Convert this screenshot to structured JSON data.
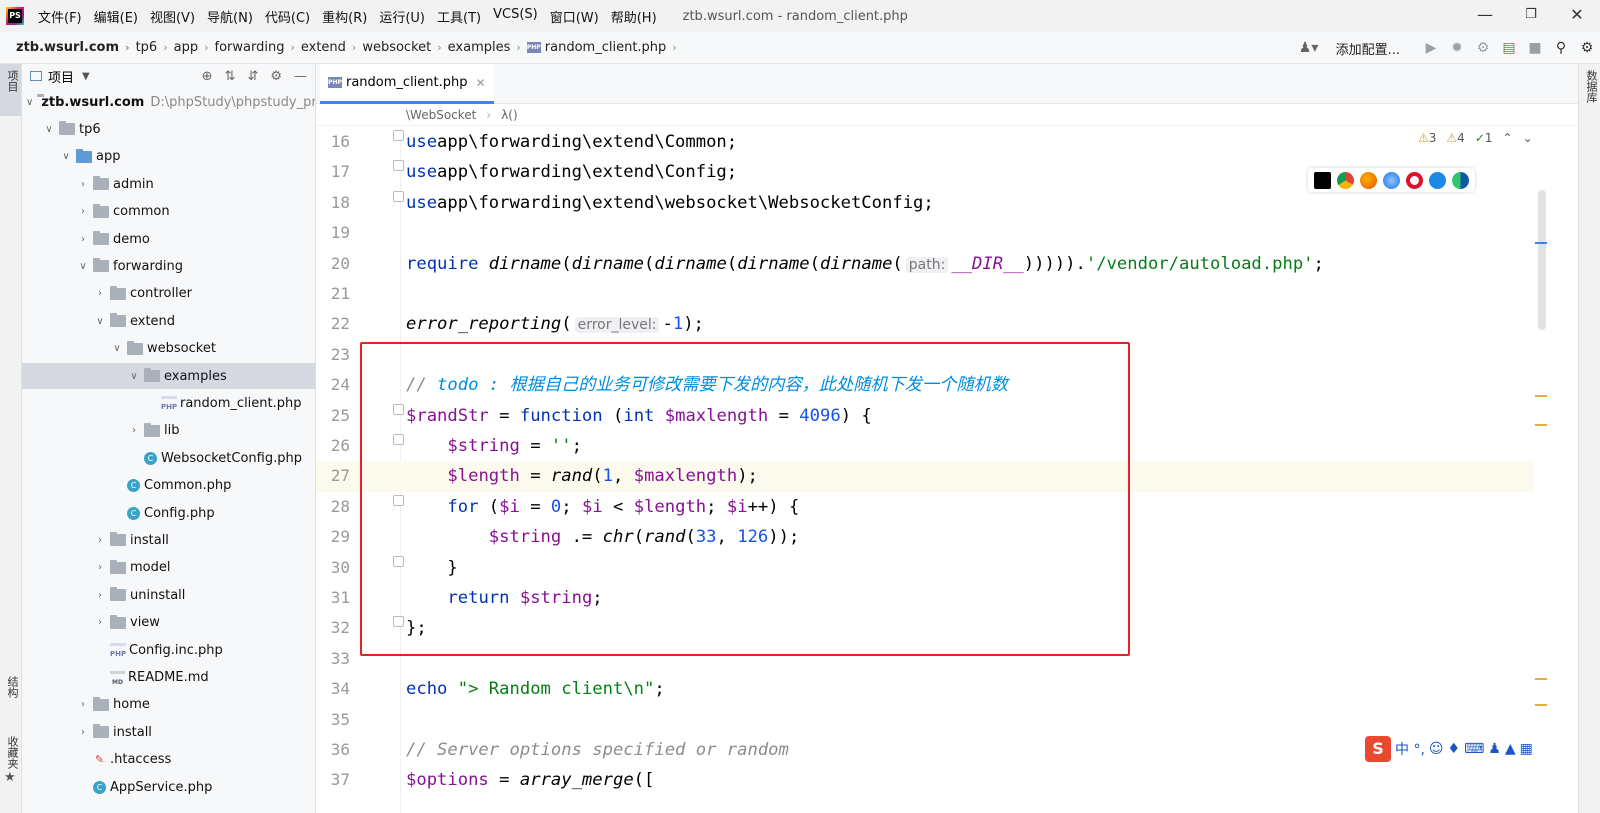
{
  "titlebar": {
    "app_icon": "phpstorm-icon",
    "logo_text": "PS",
    "menus": [
      "文件(F)",
      "编辑(E)",
      "视图(V)",
      "导航(N)",
      "代码(C)",
      "重构(R)",
      "运行(U)",
      "工具(T)",
      "VCS(S)",
      "窗口(W)",
      "帮助(H)"
    ],
    "title": "ztb.wsurl.com - random_client.php"
  },
  "navbar": {
    "crumbs": [
      "ztb.wsurl.com",
      "tp6",
      "app",
      "forwarding",
      "extend",
      "websocket",
      "examples",
      "random_client.php"
    ],
    "php_badge": "PHP",
    "add_config": "添加配置..."
  },
  "left_strip": {
    "project": "项目",
    "structure": "结构",
    "favorites": "收藏夹"
  },
  "right_strip": {
    "database": "数据库"
  },
  "project": {
    "title": "项目",
    "tree": [
      {
        "label": "ztb.wsurl.com",
        "path": "D:\\phpStudy\\phpstudy_pro\\W",
        "indent": 0,
        "icon": "folder",
        "open": true,
        "bold": true
      },
      {
        "label": "tp6",
        "indent": 1,
        "icon": "folder",
        "open": true
      },
      {
        "label": "app",
        "indent": 2,
        "icon": "folder-blue",
        "open": true
      },
      {
        "label": "admin",
        "indent": 3,
        "icon": "folder",
        "open": false
      },
      {
        "label": "common",
        "indent": 3,
        "icon": "folder",
        "open": false
      },
      {
        "label": "demo",
        "indent": 3,
        "icon": "folder",
        "open": false
      },
      {
        "label": "forwarding",
        "indent": 3,
        "icon": "folder",
        "open": true
      },
      {
        "label": "controller",
        "indent": 4,
        "icon": "folder",
        "open": false
      },
      {
        "label": "extend",
        "indent": 4,
        "icon": "folder",
        "open": true
      },
      {
        "label": "websocket",
        "indent": 5,
        "icon": "folder",
        "open": true
      },
      {
        "label": "examples",
        "indent": 6,
        "icon": "folder",
        "open": true,
        "selected": true
      },
      {
        "label": "random_client.php",
        "indent": 7,
        "icon": "php"
      },
      {
        "label": "lib",
        "indent": 6,
        "icon": "folder",
        "open": false
      },
      {
        "label": "WebsocketConfig.php",
        "indent": 6,
        "icon": "class"
      },
      {
        "label": "Common.php",
        "indent": 5,
        "icon": "class"
      },
      {
        "label": "Config.php",
        "indent": 5,
        "icon": "class"
      },
      {
        "label": "install",
        "indent": 4,
        "icon": "folder",
        "open": false
      },
      {
        "label": "model",
        "indent": 4,
        "icon": "folder",
        "open": false
      },
      {
        "label": "uninstall",
        "indent": 4,
        "icon": "folder",
        "open": false
      },
      {
        "label": "view",
        "indent": 4,
        "icon": "folder",
        "open": false
      },
      {
        "label": "Config.inc.php",
        "indent": 4,
        "icon": "php"
      },
      {
        "label": "README.md",
        "indent": 4,
        "icon": "md"
      },
      {
        "label": "home",
        "indent": 3,
        "icon": "folder",
        "open": false
      },
      {
        "label": "install",
        "indent": 3,
        "icon": "folder",
        "open": false
      },
      {
        "label": ".htaccess",
        "indent": 3,
        "icon": "htaccess"
      },
      {
        "label": "AppService.php",
        "indent": 3,
        "icon": "class"
      }
    ]
  },
  "editor": {
    "tab": "random_client.php",
    "breadcrumb": [
      "\\WebSocket",
      "λ()"
    ],
    "inspections": {
      "warnings": "3",
      "weak_warnings": "4",
      "typos": "1"
    },
    "current_line": 27,
    "lines": [
      {
        "n": "16",
        "t": [
          [
            "kw",
            "use"
          ],
          [
            "",
            "app\\forwarding\\extend\\Common;"
          ]
        ]
      },
      {
        "n": "17",
        "t": [
          [
            "kw",
            "use"
          ],
          [
            "",
            "app\\forwarding\\extend\\Config;"
          ]
        ]
      },
      {
        "n": "18",
        "t": [
          [
            "kw",
            "use"
          ],
          [
            "",
            "app\\forwarding\\extend\\websocket\\WebsocketConfig;"
          ]
        ]
      },
      {
        "n": "19",
        "t": []
      },
      {
        "n": "20",
        "t": [
          [
            "kw",
            "require "
          ],
          [
            "fn",
            "dirname"
          ],
          [
            "",
            "("
          ],
          [
            "fn",
            "dirname"
          ],
          [
            "",
            "("
          ],
          [
            "fn",
            "dirname"
          ],
          [
            "",
            "("
          ],
          [
            "fn",
            "dirname"
          ],
          [
            "",
            "("
          ],
          [
            "fn",
            "dirname"
          ],
          [
            "",
            "("
          ],
          [
            "hint",
            "path:"
          ],
          [
            "const",
            "__DIR__"
          ],
          [
            "",
            ")))))."
          ],
          [
            "str",
            "'/vendor/autoload.php'"
          ],
          [
            "",
            ";"
          ]
        ]
      },
      {
        "n": "21",
        "t": []
      },
      {
        "n": "22",
        "t": [
          [
            "fn",
            "error_reporting"
          ],
          [
            "",
            "("
          ],
          [
            "hint",
            "error_level:"
          ],
          [
            "",
            "-"
          ],
          [
            "num",
            "1"
          ],
          [
            "",
            ");"
          ]
        ]
      },
      {
        "n": "23",
        "t": []
      },
      {
        "n": "24",
        "t": [
          [
            "cmt",
            "// "
          ],
          [
            "todo",
            "todo : 根据自己的业务可修改需要下发的内容，此处随机下发一个随机数"
          ]
        ]
      },
      {
        "n": "25",
        "t": [
          [
            "var",
            "$randStr"
          ],
          [
            "",
            " = "
          ],
          [
            "kw",
            "function"
          ],
          [
            "",
            " ("
          ],
          [
            "kw",
            "int"
          ],
          [
            "",
            " "
          ],
          [
            "var",
            "$maxlength"
          ],
          [
            "",
            " = "
          ],
          [
            "num",
            "4096"
          ],
          [
            "",
            ") {"
          ]
        ]
      },
      {
        "n": "26",
        "t": [
          [
            "",
            "    "
          ],
          [
            "var",
            "$string"
          ],
          [
            "",
            " = "
          ],
          [
            "str",
            "''"
          ],
          [
            "",
            ";"
          ]
        ]
      },
      {
        "n": "27",
        "t": [
          [
            "",
            "    "
          ],
          [
            "var",
            "$length"
          ],
          [
            "",
            " = "
          ],
          [
            "fn",
            "rand"
          ],
          [
            "",
            "("
          ],
          [
            "num",
            "1"
          ],
          [
            "",
            ", "
          ],
          [
            "var",
            "$maxlength"
          ],
          [
            "",
            ");"
          ]
        ]
      },
      {
        "n": "28",
        "t": [
          [
            "",
            "    "
          ],
          [
            "kw",
            "for"
          ],
          [
            "",
            " ("
          ],
          [
            "var",
            "$i"
          ],
          [
            "",
            " = "
          ],
          [
            "num",
            "0"
          ],
          [
            "",
            "; "
          ],
          [
            "var",
            "$i"
          ],
          [
            "",
            " < "
          ],
          [
            "var",
            "$length"
          ],
          [
            "",
            "; "
          ],
          [
            "var",
            "$i"
          ],
          [
            "",
            "++) {"
          ]
        ]
      },
      {
        "n": "29",
        "t": [
          [
            "",
            "        "
          ],
          [
            "var",
            "$string"
          ],
          [
            "",
            " .= "
          ],
          [
            "fn",
            "chr"
          ],
          [
            "",
            "("
          ],
          [
            "fn",
            "rand"
          ],
          [
            "",
            "("
          ],
          [
            "num",
            "33"
          ],
          [
            "",
            ", "
          ],
          [
            "num",
            "126"
          ],
          [
            "",
            "));"
          ]
        ]
      },
      {
        "n": "30",
        "t": [
          [
            "",
            "    }"
          ]
        ]
      },
      {
        "n": "31",
        "t": [
          [
            "",
            "    "
          ],
          [
            "kw",
            "return"
          ],
          [
            "",
            " "
          ],
          [
            "var",
            "$string"
          ],
          [
            "",
            ";"
          ]
        ]
      },
      {
        "n": "32",
        "t": [
          [
            "",
            "};"
          ]
        ]
      },
      {
        "n": "33",
        "t": []
      },
      {
        "n": "34",
        "t": [
          [
            "kw",
            "echo"
          ],
          [
            "",
            " "
          ],
          [
            "str",
            "\"> Random client\\n\""
          ],
          [
            "",
            ";"
          ]
        ]
      },
      {
        "n": "35",
        "t": []
      },
      {
        "n": "36",
        "t": [
          [
            "cmt",
            "// Server options specified or random"
          ]
        ]
      },
      {
        "n": "37",
        "t": [
          [
            "var",
            "$options"
          ],
          [
            "",
            " = "
          ],
          [
            "fn",
            "array_merge"
          ],
          [
            "",
            "(["
          ]
        ]
      }
    ]
  },
  "ime": {
    "logo": "S",
    "text": "中 °,"
  },
  "colors": {
    "highlight_box": "#e12323",
    "accent": "#4083e6",
    "keyword": "#0033b3",
    "string": "#067d17",
    "variable": "#871094",
    "number": "#1750eb",
    "todo": "#008dde"
  }
}
